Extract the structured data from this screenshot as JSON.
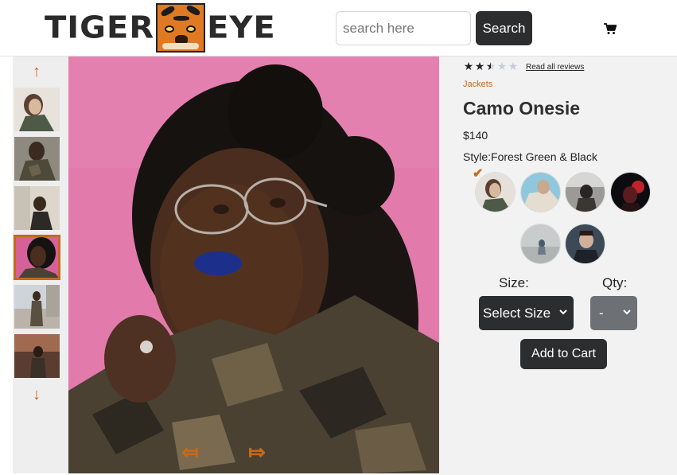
{
  "header": {
    "logo_left": "TIGER",
    "logo_right": "EYE",
    "search_placeholder": "search here",
    "search_button": "Search",
    "cart_icon": "cart-icon"
  },
  "gallery": {
    "up_arrow": "↑",
    "down_arrow": "↓",
    "prev_arrow": "⤆",
    "next_arrow": "⤇",
    "selected_thumbnail": 4,
    "thumbnail_count": 6
  },
  "product": {
    "rating": 2.5,
    "rating_max": 5,
    "reviews_link": "Read all reviews",
    "category": "Jackets",
    "title": "Camo Onesie",
    "price": "$140",
    "style_label": "Style:",
    "style_value": "Forest Green & Black",
    "check": "✔",
    "selected_style": 1,
    "style_count": 6,
    "size_label": "Size:",
    "size_value": "Select Size",
    "qty_label": "Qty:",
    "qty_value": "-",
    "add_to_cart": "Add to Cart"
  },
  "colors": {
    "accent": "#c56a1a",
    "dark_button": "#2b2d2e",
    "qty_button": "#6d7175",
    "backdrop": "#e478ac",
    "panel": "#f2f2f2"
  }
}
